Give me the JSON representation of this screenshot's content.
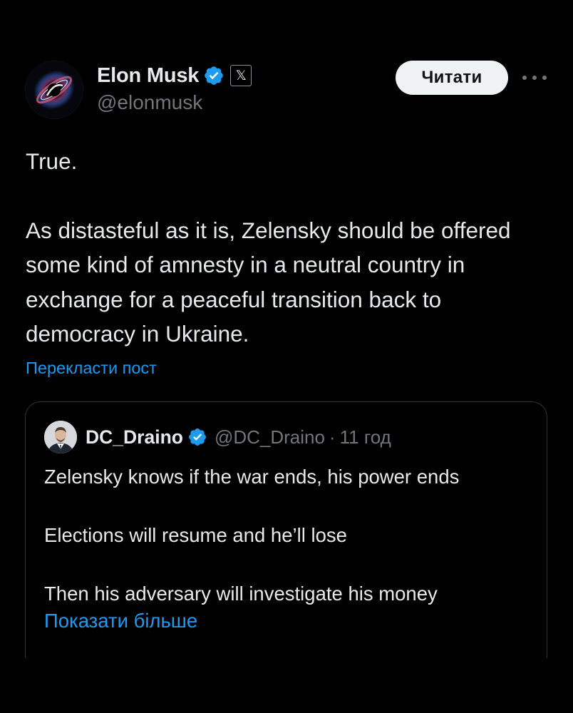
{
  "author": {
    "display_name": "Elon Musk",
    "handle": "@elonmusk",
    "verified_color": "#1d9bf0",
    "affiliate_badge_glyph": "𝕏",
    "avatar_icon": "avatar-image"
  },
  "actions": {
    "follow_label": "Читати",
    "more_icon": "more-dots-icon"
  },
  "tweet": {
    "paragraphs": [
      "True.",
      "As distasteful as it is, Zelensky should be offered some kind of amnesty in a neutral country in exchange for a peaceful transition back to democracy in Ukraine."
    ],
    "translate_label": "Перекласти пост"
  },
  "quote": {
    "display_name": "DC_Draino",
    "handle": "@DC_Draino",
    "separator": "·",
    "time": "11 год",
    "paragraphs": [
      "Zelensky knows if the war ends, his power ends",
      "Elections will resume and he’ll lose",
      "Then his adversary will investigate his money"
    ],
    "show_more_label": "Показати більше"
  },
  "colors": {
    "background": "#000000",
    "text": "#e7e9ea",
    "secondary_text": "#71767b",
    "link": "#1d9bf0",
    "border": "#2f3336",
    "button_bg": "#eff3f4"
  }
}
